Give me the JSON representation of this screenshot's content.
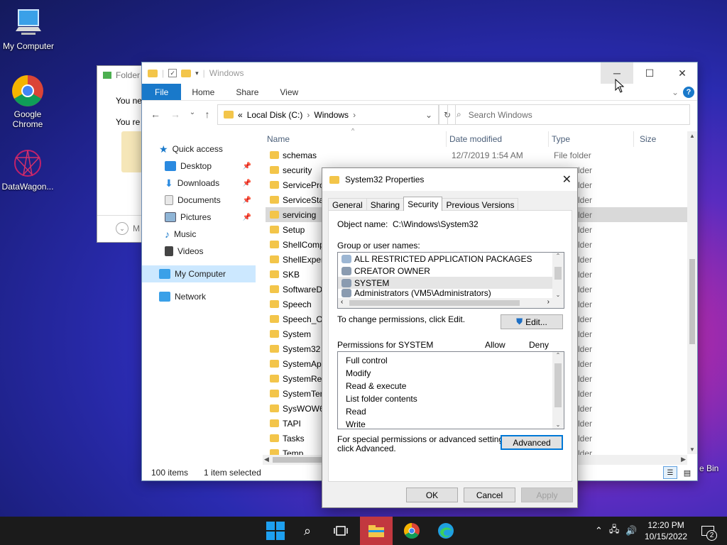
{
  "desktop": {
    "icons": [
      {
        "label": "My Computer"
      },
      {
        "label": "Google Chrome"
      },
      {
        "label": "DataWagon..."
      }
    ],
    "partial_recycle_label": "e Bin"
  },
  "back_dialog": {
    "title": "Folder",
    "line1": "You ne",
    "line2": "You re",
    "footer": "M"
  },
  "explorer": {
    "title": "Windows",
    "ribbon_tabs": [
      "File",
      "Home",
      "Share",
      "View"
    ],
    "breadcrumb": [
      "Local Disk (C:)",
      "Windows"
    ],
    "breadcrumb_prefix": "«",
    "search_placeholder": "Search Windows",
    "nav": {
      "quick_access": "Quick access",
      "items": [
        "Desktop",
        "Downloads",
        "Documents",
        "Pictures",
        "Music",
        "Videos"
      ],
      "my_computer": "My Computer",
      "network": "Network"
    },
    "columns": {
      "name": "Name",
      "date": "Date modified",
      "type": "Type",
      "size": "Size"
    },
    "files": [
      {
        "name": "schemas",
        "date": "12/7/2019 1:54 AM",
        "type": "File folder"
      },
      {
        "name": "security",
        "date": "",
        "type": "File folder"
      },
      {
        "name": "ServicePro",
        "date": "",
        "type": "File folder"
      },
      {
        "name": "ServiceStat",
        "date": "",
        "type": "File folder"
      },
      {
        "name": "servicing",
        "date": "",
        "type": "File folder"
      },
      {
        "name": "Setup",
        "date": "",
        "type": "File folder"
      },
      {
        "name": "ShellComp",
        "date": "",
        "type": "File folder"
      },
      {
        "name": "ShellExper",
        "date": "",
        "type": "File folder"
      },
      {
        "name": "SKB",
        "date": "",
        "type": "File folder"
      },
      {
        "name": "SoftwareDi",
        "date": "",
        "type": "File folder"
      },
      {
        "name": "Speech",
        "date": "",
        "type": "File folder"
      },
      {
        "name": "Speech_On",
        "date": "",
        "type": "File folder"
      },
      {
        "name": "System",
        "date": "",
        "type": "File folder"
      },
      {
        "name": "System32",
        "date": "",
        "type": "File folder"
      },
      {
        "name": "SystemApp",
        "date": "",
        "type": "File folder"
      },
      {
        "name": "SystemRes",
        "date": "",
        "type": "File folder"
      },
      {
        "name": "SystemTem",
        "date": "",
        "type": "File folder"
      },
      {
        "name": "SysWOW64",
        "date": "",
        "type": "File folder"
      },
      {
        "name": "TAPI",
        "date": "",
        "type": "File folder"
      },
      {
        "name": "Tasks",
        "date": "",
        "type": "File folder"
      },
      {
        "name": "Temp",
        "date": "",
        "type": "File folder"
      }
    ],
    "type_partial": "lder",
    "status_count": "100 items",
    "status_selected": "1 item selected"
  },
  "properties": {
    "title": "System32 Properties",
    "tabs": [
      "General",
      "Sharing",
      "Security",
      "Previous Versions"
    ],
    "object_name_label": "Object name:",
    "object_name_value": "C:\\Windows\\System32",
    "group_label": "Group or user names:",
    "groups": [
      "ALL RESTRICTED APPLICATION PACKAGES",
      "CREATOR OWNER",
      "SYSTEM",
      "Administrators (VM5\\Administrators)"
    ],
    "change_text": "To change permissions, click Edit.",
    "edit_button": "Edit...",
    "permissions_label": "Permissions for SYSTEM",
    "allow_label": "Allow",
    "deny_label": "Deny",
    "permissions": [
      "Full control",
      "Modify",
      "Read & execute",
      "List folder contents",
      "Read",
      "Write"
    ],
    "special_text_1": "For special permissions or advanced settings,",
    "special_text_2": "click Advanced.",
    "advanced_button": "Advanced",
    "ok_button": "OK",
    "cancel_button": "Cancel",
    "apply_button": "Apply"
  },
  "taskbar": {
    "time": "12:20 PM",
    "date": "10/15/2022",
    "notification_count": "2"
  },
  "colors": {
    "accent": "#1979ca",
    "folder": "#f3c54a",
    "selection": "#cce8ff"
  }
}
